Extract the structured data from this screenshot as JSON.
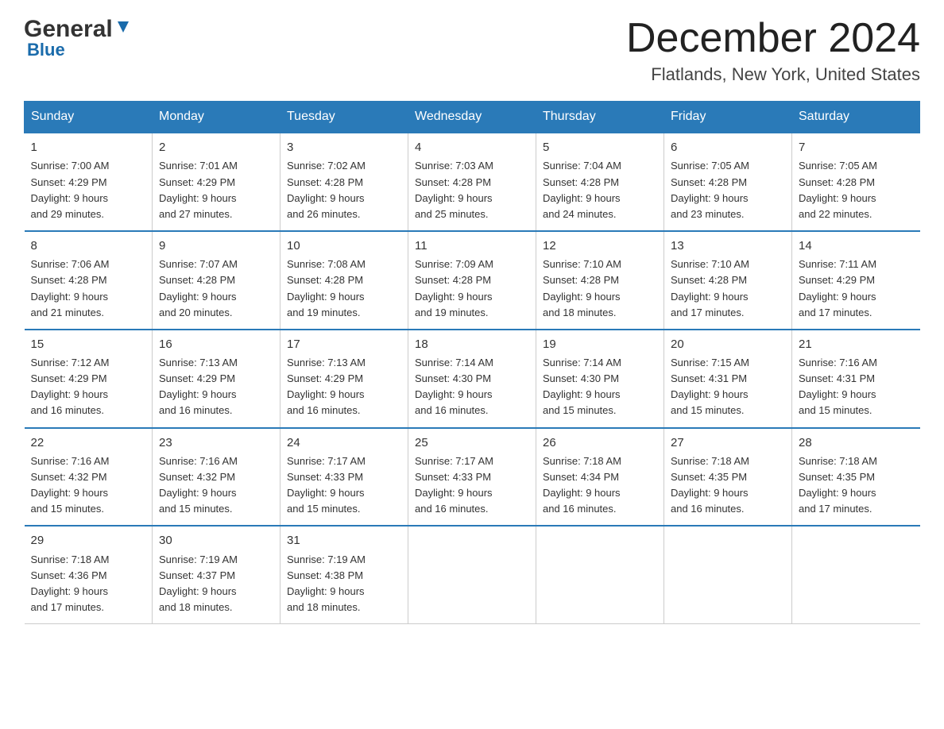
{
  "header": {
    "logo": {
      "general": "General",
      "blue": "Blue"
    },
    "title": "December 2024",
    "location": "Flatlands, New York, United States"
  },
  "weekdays": [
    "Sunday",
    "Monday",
    "Tuesday",
    "Wednesday",
    "Thursday",
    "Friday",
    "Saturday"
  ],
  "weeks": [
    [
      {
        "day": "1",
        "sunrise": "7:00 AM",
        "sunset": "4:29 PM",
        "daylight": "9 hours and 29 minutes."
      },
      {
        "day": "2",
        "sunrise": "7:01 AM",
        "sunset": "4:29 PM",
        "daylight": "9 hours and 27 minutes."
      },
      {
        "day": "3",
        "sunrise": "7:02 AM",
        "sunset": "4:28 PM",
        "daylight": "9 hours and 26 minutes."
      },
      {
        "day": "4",
        "sunrise": "7:03 AM",
        "sunset": "4:28 PM",
        "daylight": "9 hours and 25 minutes."
      },
      {
        "day": "5",
        "sunrise": "7:04 AM",
        "sunset": "4:28 PM",
        "daylight": "9 hours and 24 minutes."
      },
      {
        "day": "6",
        "sunrise": "7:05 AM",
        "sunset": "4:28 PM",
        "daylight": "9 hours and 23 minutes."
      },
      {
        "day": "7",
        "sunrise": "7:05 AM",
        "sunset": "4:28 PM",
        "daylight": "9 hours and 22 minutes."
      }
    ],
    [
      {
        "day": "8",
        "sunrise": "7:06 AM",
        "sunset": "4:28 PM",
        "daylight": "9 hours and 21 minutes."
      },
      {
        "day": "9",
        "sunrise": "7:07 AM",
        "sunset": "4:28 PM",
        "daylight": "9 hours and 20 minutes."
      },
      {
        "day": "10",
        "sunrise": "7:08 AM",
        "sunset": "4:28 PM",
        "daylight": "9 hours and 19 minutes."
      },
      {
        "day": "11",
        "sunrise": "7:09 AM",
        "sunset": "4:28 PM",
        "daylight": "9 hours and 19 minutes."
      },
      {
        "day": "12",
        "sunrise": "7:10 AM",
        "sunset": "4:28 PM",
        "daylight": "9 hours and 18 minutes."
      },
      {
        "day": "13",
        "sunrise": "7:10 AM",
        "sunset": "4:28 PM",
        "daylight": "9 hours and 17 minutes."
      },
      {
        "day": "14",
        "sunrise": "7:11 AM",
        "sunset": "4:29 PM",
        "daylight": "9 hours and 17 minutes."
      }
    ],
    [
      {
        "day": "15",
        "sunrise": "7:12 AM",
        "sunset": "4:29 PM",
        "daylight": "9 hours and 16 minutes."
      },
      {
        "day": "16",
        "sunrise": "7:13 AM",
        "sunset": "4:29 PM",
        "daylight": "9 hours and 16 minutes."
      },
      {
        "day": "17",
        "sunrise": "7:13 AM",
        "sunset": "4:29 PM",
        "daylight": "9 hours and 16 minutes."
      },
      {
        "day": "18",
        "sunrise": "7:14 AM",
        "sunset": "4:30 PM",
        "daylight": "9 hours and 16 minutes."
      },
      {
        "day": "19",
        "sunrise": "7:14 AM",
        "sunset": "4:30 PM",
        "daylight": "9 hours and 15 minutes."
      },
      {
        "day": "20",
        "sunrise": "7:15 AM",
        "sunset": "4:31 PM",
        "daylight": "9 hours and 15 minutes."
      },
      {
        "day": "21",
        "sunrise": "7:16 AM",
        "sunset": "4:31 PM",
        "daylight": "9 hours and 15 minutes."
      }
    ],
    [
      {
        "day": "22",
        "sunrise": "7:16 AM",
        "sunset": "4:32 PM",
        "daylight": "9 hours and 15 minutes."
      },
      {
        "day": "23",
        "sunrise": "7:16 AM",
        "sunset": "4:32 PM",
        "daylight": "9 hours and 15 minutes."
      },
      {
        "day": "24",
        "sunrise": "7:17 AM",
        "sunset": "4:33 PM",
        "daylight": "9 hours and 15 minutes."
      },
      {
        "day": "25",
        "sunrise": "7:17 AM",
        "sunset": "4:33 PM",
        "daylight": "9 hours and 16 minutes."
      },
      {
        "day": "26",
        "sunrise": "7:18 AM",
        "sunset": "4:34 PM",
        "daylight": "9 hours and 16 minutes."
      },
      {
        "day": "27",
        "sunrise": "7:18 AM",
        "sunset": "4:35 PM",
        "daylight": "9 hours and 16 minutes."
      },
      {
        "day": "28",
        "sunrise": "7:18 AM",
        "sunset": "4:35 PM",
        "daylight": "9 hours and 17 minutes."
      }
    ],
    [
      {
        "day": "29",
        "sunrise": "7:18 AM",
        "sunset": "4:36 PM",
        "daylight": "9 hours and 17 minutes."
      },
      {
        "day": "30",
        "sunrise": "7:19 AM",
        "sunset": "4:37 PM",
        "daylight": "9 hours and 18 minutes."
      },
      {
        "day": "31",
        "sunrise": "7:19 AM",
        "sunset": "4:38 PM",
        "daylight": "9 hours and 18 minutes."
      },
      null,
      null,
      null,
      null
    ]
  ],
  "labels": {
    "sunrise": "Sunrise:",
    "sunset": "Sunset:",
    "daylight": "Daylight:"
  }
}
